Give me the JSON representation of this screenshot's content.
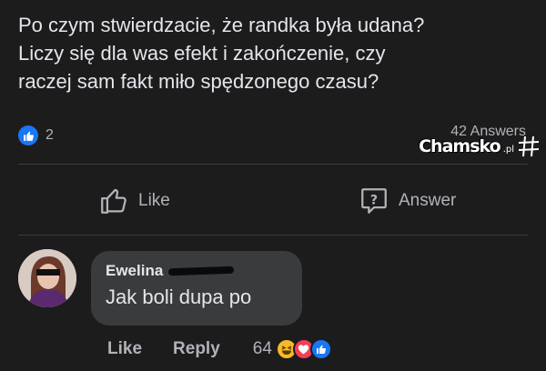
{
  "post": {
    "lines": [
      "Po czym stwierdzacie, że randka była udana?",
      "Liczy się dla was efekt i zakończenie, czy",
      "raczej sam fakt miło spędzonego czasu?"
    ],
    "reaction_count": "2",
    "answers_count": "42 Answers"
  },
  "watermark": {
    "name": "Chamsko",
    "tld": ".pl"
  },
  "actions": {
    "like_label": "Like",
    "answer_label": "Answer"
  },
  "comment": {
    "author": "Ewelina",
    "text": "Jak boli dupa po",
    "like_label": "Like",
    "reply_label": "Reply",
    "reaction_count": "64"
  },
  "colors": {
    "background": "#1c1c1d",
    "bubble": "#3a3b3c",
    "like_blue": "#1877f2",
    "love_red": "#f33e58",
    "haha_yellow": "#f7b928"
  }
}
